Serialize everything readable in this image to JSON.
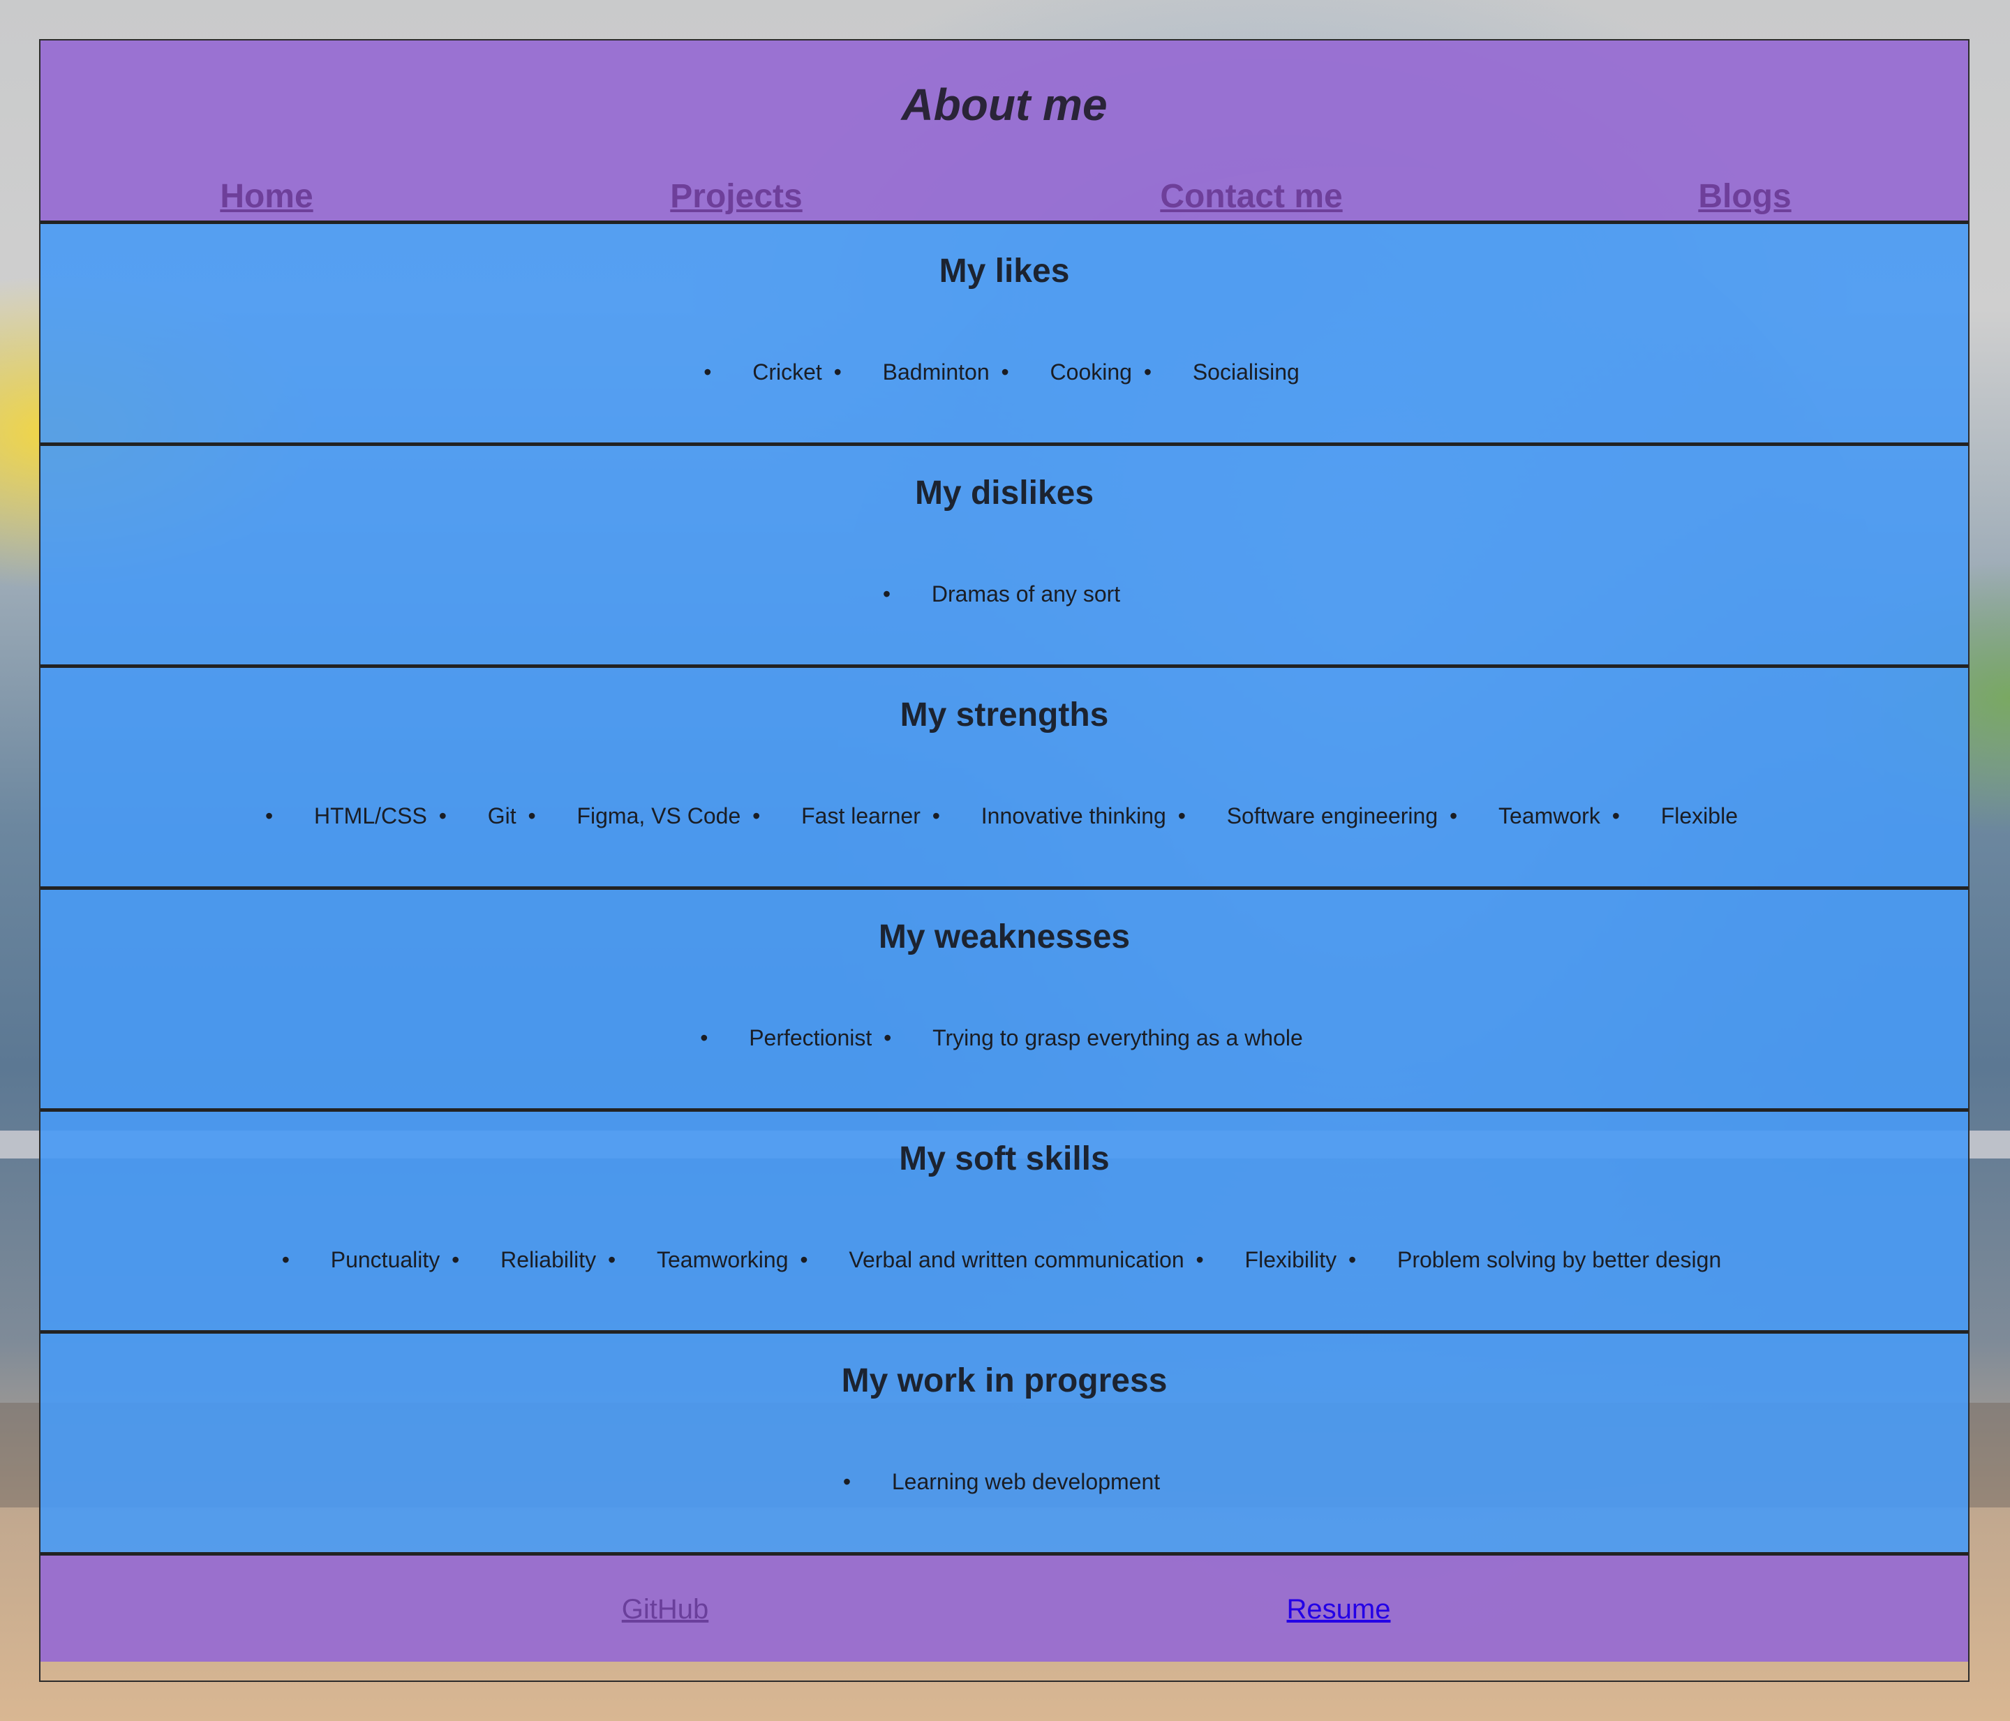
{
  "header": {
    "title": "About me",
    "nav": [
      "Home",
      "Projects",
      "Contact me",
      "Blogs"
    ]
  },
  "sections": [
    {
      "title": "My likes",
      "items": [
        "Cricket",
        "Badminton",
        "Cooking",
        "Socialising"
      ]
    },
    {
      "title": "My dislikes",
      "items": [
        "Dramas of any sort"
      ]
    },
    {
      "title": "My strengths",
      "items": [
        "HTML/CSS",
        "Git",
        "Figma, VS Code",
        "Fast learner",
        "Innovative thinking",
        "Software engineering",
        "Teamwork",
        "Flexible"
      ]
    },
    {
      "title": "My weaknesses",
      "items": [
        "Perfectionist",
        "Trying to grasp everything as a whole"
      ]
    },
    {
      "title": "My soft skills",
      "items": [
        "Punctuality",
        "Reliability",
        "Teamworking",
        "Verbal and written communication",
        "Flexibility",
        "Problem solving by better design"
      ]
    },
    {
      "title": "My work in progress",
      "items": [
        "Learning web development"
      ]
    }
  ],
  "footer": {
    "links": [
      "GitHub",
      "Resume"
    ]
  },
  "colors": {
    "header_bg": "#966ad2",
    "section_bg": "#489af5",
    "nav_link": "#6e3f9a",
    "github_link_visited": "#6a3f9b",
    "resume_link": "#2400e6"
  }
}
